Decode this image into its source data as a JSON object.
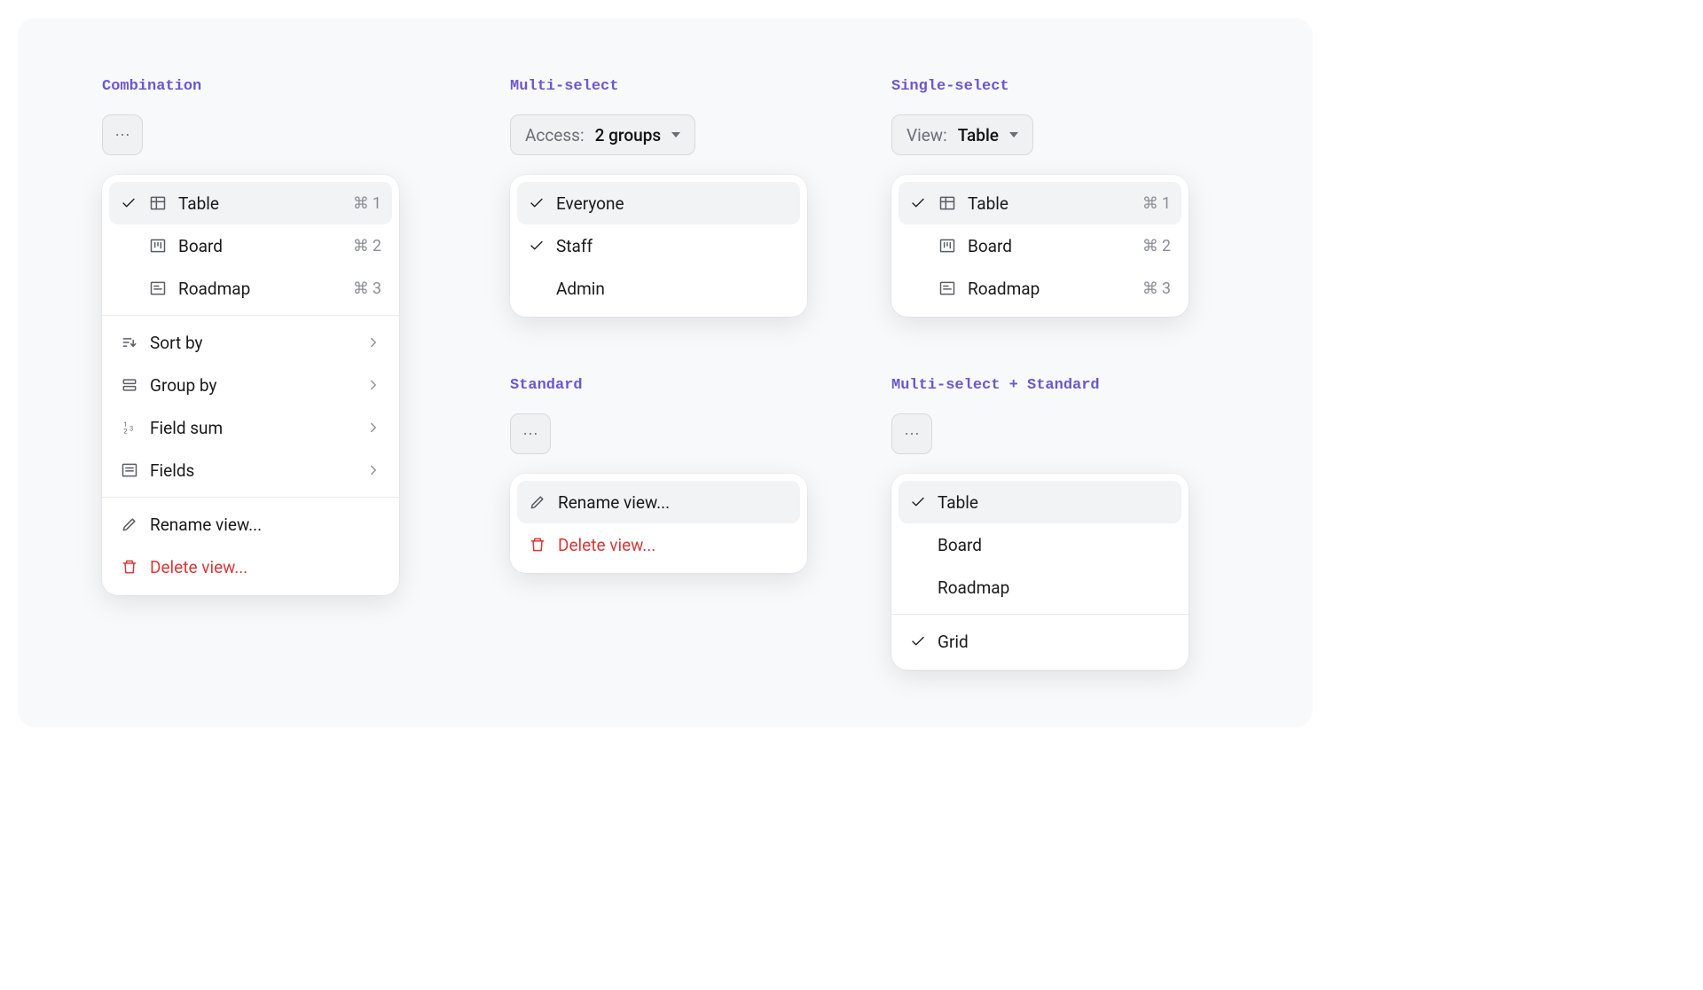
{
  "sections": {
    "combination": {
      "label": "Combination",
      "views": [
        {
          "label": "Table",
          "shortcut_sym": "⌘",
          "shortcut_key": "1",
          "selected": true
        },
        {
          "label": "Board",
          "shortcut_sym": "⌘",
          "shortcut_key": "2",
          "selected": false
        },
        {
          "label": "Roadmap",
          "shortcut_sym": "⌘",
          "shortcut_key": "3",
          "selected": false
        }
      ],
      "config": [
        {
          "label": "Sort by"
        },
        {
          "label": "Group by"
        },
        {
          "label": "Field sum"
        },
        {
          "label": "Fields"
        }
      ],
      "actions": [
        {
          "label": "Rename view...",
          "kind": "rename"
        },
        {
          "label": "Delete view...",
          "kind": "delete"
        }
      ]
    },
    "multiselect": {
      "label": "Multi-select",
      "trigger": {
        "prefix": "Access:",
        "value": "2 groups"
      },
      "items": [
        {
          "label": "Everyone",
          "selected": true
        },
        {
          "label": "Staff",
          "selected": true
        },
        {
          "label": "Admin",
          "selected": false
        }
      ]
    },
    "singleselect": {
      "label": "Single-select",
      "trigger": {
        "prefix": "View:",
        "value": "Table"
      },
      "items": [
        {
          "label": "Table",
          "shortcut_sym": "⌘",
          "shortcut_key": "1",
          "selected": true
        },
        {
          "label": "Board",
          "shortcut_sym": "⌘",
          "shortcut_key": "2",
          "selected": false
        },
        {
          "label": "Roadmap",
          "shortcut_sym": "⌘",
          "shortcut_key": "3",
          "selected": false
        }
      ]
    },
    "standard": {
      "label": "Standard",
      "actions": [
        {
          "label": "Rename view...",
          "kind": "rename"
        },
        {
          "label": "Delete view...",
          "kind": "delete"
        }
      ]
    },
    "ms_standard": {
      "label": "Multi-select + Standard",
      "group1": [
        {
          "label": "Table",
          "selected": true
        },
        {
          "label": "Board",
          "selected": false
        },
        {
          "label": "Roadmap",
          "selected": false
        }
      ],
      "group2": [
        {
          "label": "Grid",
          "selected": true
        }
      ]
    }
  }
}
